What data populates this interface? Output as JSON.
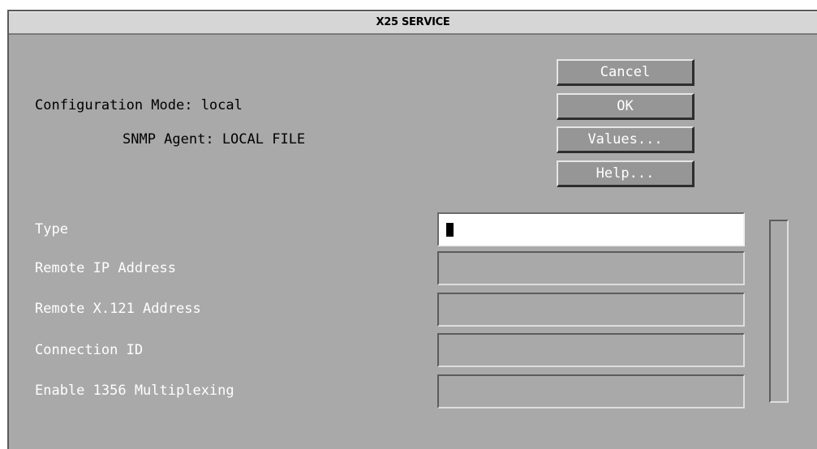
{
  "window": {
    "title": "X25 SERVICE"
  },
  "info": {
    "config_mode_label": "Configuration Mode: local",
    "snmp_agent_label": "SNMP Agent: LOCAL FILE"
  },
  "buttons": {
    "cancel": "Cancel",
    "ok": "OK",
    "values": "Values...",
    "help": "Help..."
  },
  "fields": [
    {
      "label": "Type",
      "value": "",
      "focused": true
    },
    {
      "label": "Remote IP Address",
      "value": ""
    },
    {
      "label": "Remote X.121 Address",
      "value": ""
    },
    {
      "label": "Connection ID",
      "value": ""
    },
    {
      "label": "Enable 1356 Multiplexing",
      "value": ""
    }
  ],
  "colors": {
    "background": "#a9a9a9",
    "titlebar": "#d6d6d6",
    "button": "#969696",
    "active_field": "#ffffff"
  }
}
